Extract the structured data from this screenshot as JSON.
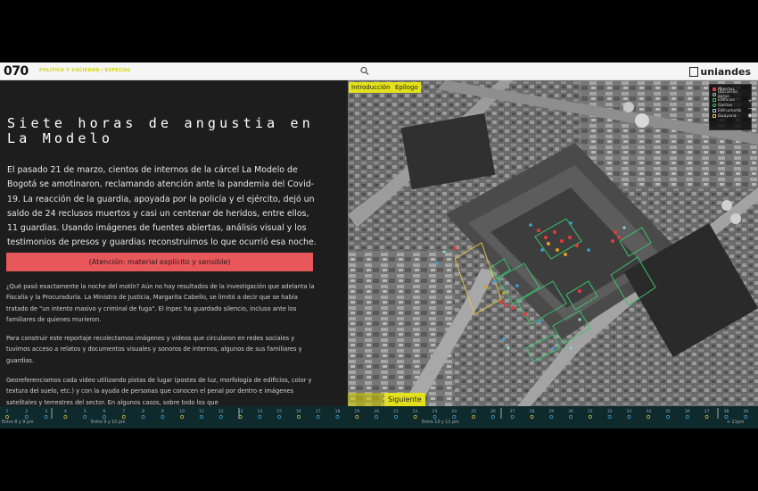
{
  "header": {
    "logo": "070",
    "breadcrumb": "POLÍTICA Y SOCIEDAD / ESPECIAL",
    "brand": "uniandes"
  },
  "article": {
    "title": "Siete horas de angustia en La Modelo",
    "intro": "El pasado 21 de marzo, cientos de internos de la cárcel La Modelo de Bogotá se amotinaron, reclamando atención ante la pandemia del Covid-19. La reacción de la guardia, apoyada por la policía y el ejército, dejó un saldo de 24 reclusos muertos y casi un centenar de heridos, entre ellos, 11 guardias. Usando imágenes de fuentes abiertas, análisis visual y los testimonios de presos y guardias reconstruimos lo que ocurrió esa noche.",
    "warning": "(Atención: material explícito y sensible)",
    "paragraphs": [
      "¿Qué pasó exactamente la noche del motín? Aún no hay resultados de la investigación que adelanta la Fiscalía y la Procuraduría. La Ministra de Justicia, Margarita Cabello, se limitó a decir que se había tratado de \"un intento masivo y criminal de fuga\". El Inpec ha guardado silencio, incluso ante los familiares de quienes murieron.",
      "Para construir este reportaje recolectamos imágenes y videos que circularon en redes sociales y tuvimos acceso a relatos y documentos visuales y sonoros de internos, algunos de sus familiares y guardias.",
      "Georeferenciamos cada video utilizando pistas de lugar (postes de luz, morfología de edificios, color y textura del suelo, etc.) y con la ayuda de personas que conocen el penal por dentro e imágenes satelitales y terrestres del sector. En algunos casos, sobre todo los que"
    ]
  },
  "map": {
    "nav_intro": "Introducción",
    "nav_epilogo": "Epílogo",
    "nav_next": "Siguiente",
    "legend": [
      {
        "label": "Muertos",
        "color": "#e23b3b"
      },
      {
        "label": "Ubicación aprox.",
        "color": "#bbbbbb"
      },
      {
        "label": "Edificios",
        "color": "#38c46a"
      },
      {
        "label": "Garitas",
        "color": "#38c46a"
      },
      {
        "label": "Estructuras",
        "color": "#8fd0d8"
      },
      {
        "label": "Guayana",
        "color": "#e0c040"
      }
    ],
    "tools": [
      "+",
      "−",
      "◉"
    ]
  },
  "timeline": {
    "labels": [
      "Entre 8 y 9 pm",
      "Entre 9 y 10 pm",
      "Entre 10 y 11 pm",
      "+ 11pm"
    ],
    "numbers": [
      "1",
      "2",
      "3",
      "4",
      "5",
      "6",
      "7",
      "8",
      "9",
      "10",
      "11",
      "12",
      "13",
      "14",
      "15",
      "16",
      "17",
      "18",
      "19",
      "20",
      "21",
      "22",
      "23",
      "24",
      "25",
      "26",
      "27",
      "28",
      "29",
      "30",
      "31",
      "32",
      "33",
      "34",
      "35",
      "36",
      "37",
      "38",
      "39"
    ]
  },
  "colors": {
    "accent": "#e3e11b",
    "warning": "#e8575a",
    "timeline_bg": "#0e2a2c"
  }
}
